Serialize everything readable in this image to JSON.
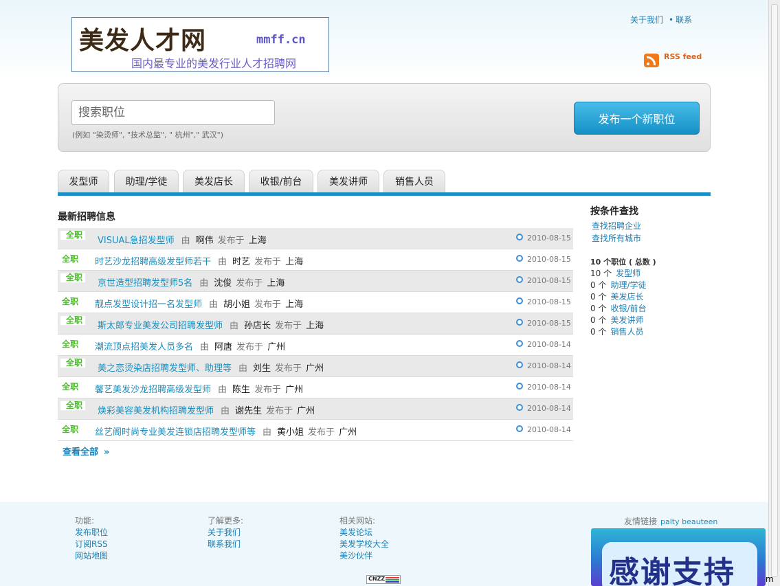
{
  "header": {
    "logo": {
      "brand": "美发人才网",
      "domain": "mmff.cn",
      "slogan": "国内最专业的美发行业人才招聘网"
    },
    "links": [
      "关于我们",
      "联系"
    ],
    "link_separator": "•",
    "rss_label": "RSS feed"
  },
  "search": {
    "placeholder": "搜索职位",
    "hint": "(例如  \"染烫师\", \"技术总监\", \" 杭州\",\" 武汉\")",
    "post_button": "发布一个新职位"
  },
  "tabs": [
    "发型师",
    "助理/学徒",
    "美发店长",
    "收银/前台",
    "美发讲师",
    "销售人员"
  ],
  "listings": {
    "title": "最新招聘信息",
    "by_label": "由",
    "posted_label": "发布于",
    "jobs": [
      {
        "type": "全职",
        "title": "VISUAL急招发型师",
        "company": "啊伟",
        "city": "上海",
        "date": "2010-08-15"
      },
      {
        "type": "全职",
        "title": "时艺沙龙招聘高级发型师若干",
        "company": "时艺",
        "city": "上海",
        "date": "2010-08-15"
      },
      {
        "type": "全职",
        "title": "京世造型招聘发型师5名",
        "company": "沈俊",
        "city": "上海",
        "date": "2010-08-15"
      },
      {
        "type": "全职",
        "title": "靓点发型设计招一名发型师",
        "company": "胡小姐",
        "city": "上海",
        "date": "2010-08-15"
      },
      {
        "type": "全职",
        "title": "斯太郎专业美发公司招聘发型师",
        "company": "孙店长",
        "city": "上海",
        "date": "2010-08-15"
      },
      {
        "type": "全职",
        "title": "潮流顶点招美发人员多名",
        "company": "阿唐",
        "city": "广州",
        "date": "2010-08-14"
      },
      {
        "type": "全职",
        "title": "美之恋烫染店招聘发型师、助理等",
        "company": "刘生",
        "city": "广州",
        "date": "2010-08-14"
      },
      {
        "type": "全职",
        "title": "馨艺美发沙龙招聘高级发型师",
        "company": "陈生",
        "city": "广州",
        "date": "2010-08-14"
      },
      {
        "type": "全职",
        "title": "焕彩美容美发机构招聘发型师",
        "company": "谢先生",
        "city": "广州",
        "date": "2010-08-14"
      },
      {
        "type": "全职",
        "title": "丝艺阁时尚专业美发连锁店招聘发型师等",
        "company": "黄小姐",
        "city": "广州",
        "date": "2010-08-14"
      }
    ],
    "view_all": "查看全部",
    "view_all_arrow": "»"
  },
  "sidebar": {
    "title": "按条件查找",
    "links": [
      "查找招聘企业",
      "查找所有城市"
    ],
    "total": "10 个职位 ( 总数 )",
    "categories": [
      {
        "count": "10 个",
        "name": "发型师"
      },
      {
        "count": "0 个",
        "name": "助理/学徒"
      },
      {
        "count": "0 个",
        "name": "美发店长"
      },
      {
        "count": "0 个",
        "name": "收银/前台"
      },
      {
        "count": "0 个",
        "name": "美发讲师"
      },
      {
        "count": "0 个",
        "name": "销售人员"
      }
    ]
  },
  "footer": {
    "columns": [
      {
        "head": "功能:",
        "links": [
          "发布职位",
          "订阅RSS",
          "网站地图"
        ]
      },
      {
        "head": "了解更多:",
        "links": [
          "关于我们",
          "联系我们"
        ]
      },
      {
        "head": "相关网站:",
        "links": [
          "美发论坛",
          "美发学校大全",
          "美沙伙伴"
        ]
      }
    ],
    "friends_label": "友情链接",
    "friends_link": "palty beauteen",
    "banner_text": "感谢支持",
    "counter_text": "CNZZ",
    "edge_text": "m"
  },
  "colors": {
    "accent": "#1c8fc8",
    "link": "#1a7fb5",
    "fulltime": "#4fbd2f"
  }
}
